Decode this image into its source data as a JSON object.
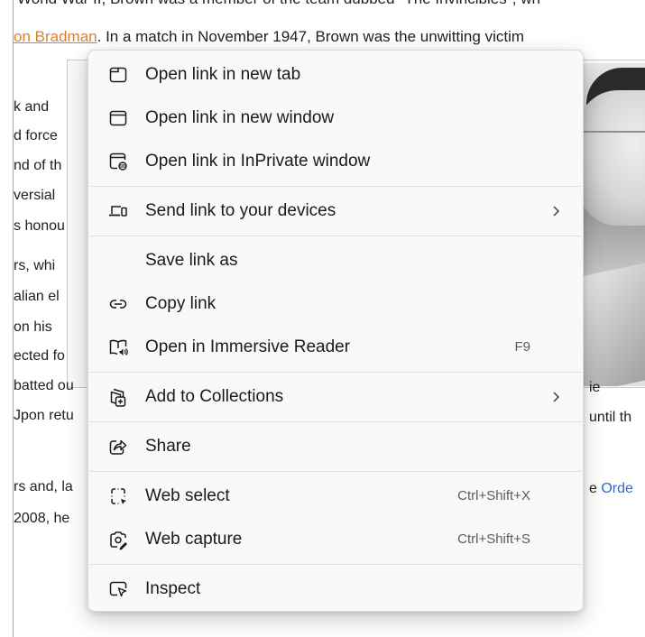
{
  "article": {
    "top_line": "World War II, Brown was a member of the team dubbed \"The Invincibles\", wh",
    "second_line_link": "on Bradman",
    "second_line_text": ". In a match in November 1947, Brown was the unwitting victim",
    "left_fragments": [
      "k and",
      "d force",
      "nd of th",
      "versial",
      "s honou",
      "rs, whi",
      "alian el",
      "on his",
      "ected fo",
      "batted ou",
      "Jpon retu",
      "rs and, la",
      "2008, he"
    ],
    "right_fragments": {
      "ie": "ie",
      "until": "until th",
      "orde_prefix": "e ",
      "orde_link": "Orde"
    }
  },
  "menu": {
    "open_new_tab": "Open link in new tab",
    "open_new_window": "Open link in new window",
    "open_inprivate": "Open link in InPrivate window",
    "send_devices": "Send link to your devices",
    "save_link_as": "Save link as",
    "copy_link": "Copy link",
    "immersive_reader": "Open in Immersive Reader",
    "immersive_shortcut": "F9",
    "add_collections": "Add to Collections",
    "share": "Share",
    "web_select": "Web select",
    "web_select_shortcut": "Ctrl+Shift+X",
    "web_capture": "Web capture",
    "web_capture_shortcut": "Ctrl+Shift+S",
    "inspect": "Inspect"
  },
  "icons": {
    "new_tab": "new-tab-icon",
    "new_window": "new-window-icon",
    "inprivate": "inprivate-window-icon",
    "devices": "devices-icon",
    "copy_link": "link-icon",
    "immersive_reader": "immersive-reader-icon",
    "collections": "collections-icon",
    "share": "share-icon",
    "web_select": "web-select-icon",
    "web_capture": "web-capture-icon",
    "inspect": "inspect-icon",
    "chevron": "chevron-right-icon"
  },
  "colors": {
    "link_orange": "#d9822b",
    "link_blue": "#3366cc",
    "menu_bg": "#f9f9f9",
    "text": "#1a1a1a"
  }
}
